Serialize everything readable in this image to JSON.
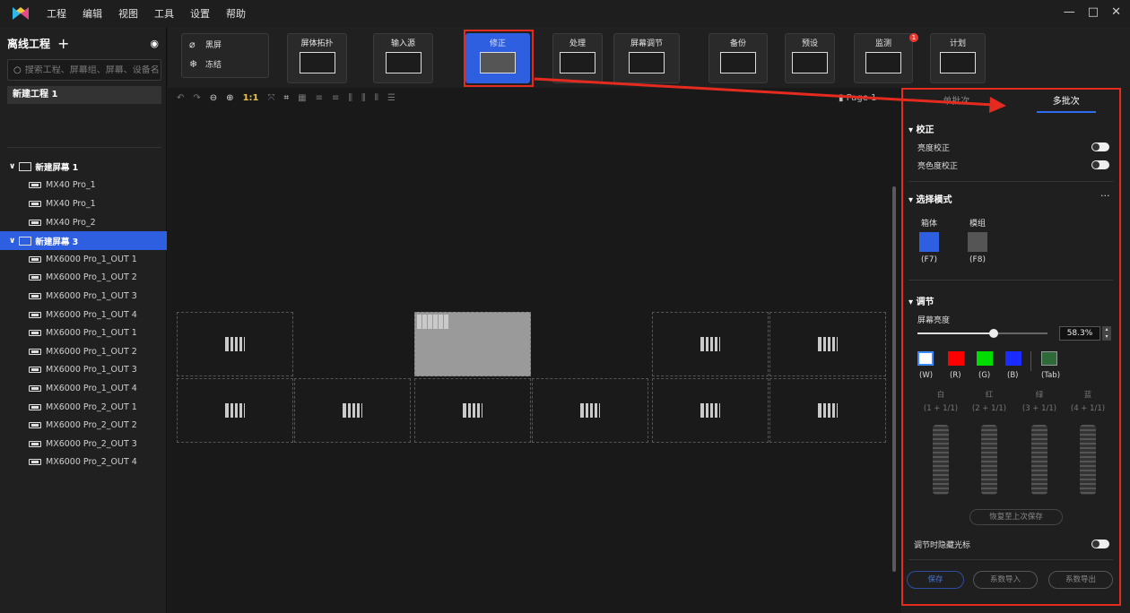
{
  "menubar": {
    "items": [
      "工程",
      "编辑",
      "视图",
      "工具",
      "设置",
      "帮助"
    ],
    "window_controls": [
      "—",
      "□",
      "✕"
    ]
  },
  "left": {
    "title": "离线工程",
    "add": "+",
    "search_placeholder": "搜索工程、屏幕组、屏幕、设备名...",
    "project_item": "新建工程 1",
    "tree": [
      {
        "type": "screen",
        "label": "新建屏幕 1",
        "selected": false
      },
      {
        "type": "device",
        "label": "MX40 Pro_1"
      },
      {
        "type": "device",
        "label": "MX40 Pro_1"
      },
      {
        "type": "device",
        "label": "MX40 Pro_2"
      },
      {
        "type": "screen",
        "label": "新建屏幕 3",
        "selected": true
      },
      {
        "type": "device",
        "label": "MX6000 Pro_1_OUT 1"
      },
      {
        "type": "device",
        "label": "MX6000 Pro_1_OUT 2"
      },
      {
        "type": "device",
        "label": "MX6000 Pro_1_OUT 3"
      },
      {
        "type": "device",
        "label": "MX6000 Pro_1_OUT 4"
      },
      {
        "type": "device",
        "label": "MX6000 Pro_1_OUT 1"
      },
      {
        "type": "device",
        "label": "MX6000 Pro_1_OUT 2"
      },
      {
        "type": "device",
        "label": "MX6000 Pro_1_OUT 3"
      },
      {
        "type": "device",
        "label": "MX6000 Pro_1_OUT 4"
      },
      {
        "type": "device",
        "label": "MX6000 Pro_2_OUT 1"
      },
      {
        "type": "device",
        "label": "MX6000 Pro_2_OUT 2"
      },
      {
        "type": "device",
        "label": "MX6000 Pro_2_OUT 3"
      },
      {
        "type": "device",
        "label": "MX6000 Pro_2_OUT 4"
      }
    ]
  },
  "ribbon": {
    "black_screen": "黑屏",
    "freeze": "冻结",
    "buttons": [
      {
        "label": "屏体拓扑",
        "icon": "topology-icon"
      },
      {
        "label": "输入源",
        "icon": "input-source-icon"
      },
      {
        "label": "修正",
        "icon": "correction-icon",
        "active": true
      },
      {
        "label": "处理",
        "icon": "processing-icon"
      },
      {
        "label": "屏幕调节",
        "icon": "screen-adjust-icon"
      },
      {
        "label": "备份",
        "icon": "backup-icon"
      },
      {
        "label": "预设",
        "icon": "preset-icon"
      },
      {
        "label": "监测",
        "icon": "monitor-icon",
        "badge": "1"
      },
      {
        "label": "计划",
        "icon": "schedule-icon"
      }
    ]
  },
  "canvas": {
    "zoom_label": "1:1",
    "page_label": "Page 1"
  },
  "right": {
    "tabs": [
      "单批次",
      "多批次"
    ],
    "active_tab": 1,
    "correction": {
      "title": "校正",
      "brightness": "亮度校正",
      "chroma": "亮色度校正"
    },
    "select_mode": {
      "title": "选择模式",
      "more": "···",
      "modes": [
        {
          "label": "箱体",
          "key": "(F7)"
        },
        {
          "label": "模组",
          "key": "(F8)"
        }
      ]
    },
    "adjust": {
      "title": "调节",
      "screen_brightness": "屏幕亮度",
      "brightness_value": "58.3%",
      "brightness_level": 58.3,
      "swatches": [
        {
          "key": "(W)",
          "color": "#ffffff"
        },
        {
          "key": "(R)",
          "color": "#ff0000"
        },
        {
          "key": "(G)",
          "color": "#00dd00"
        },
        {
          "key": "(B)",
          "color": "#1a2cff"
        }
      ],
      "tab_key": "(Tab)",
      "channels": [
        {
          "name": "白",
          "formula": "(1 + 1/1)"
        },
        {
          "name": "红",
          "formula": "(2 + 1/1)"
        },
        {
          "name": "绿",
          "formula": "(3 + 1/1)"
        },
        {
          "name": "蓝",
          "formula": "(4 + 1/1)"
        }
      ],
      "restore": "恢复至上次保存",
      "hide_cursor": "调节时隐藏光标"
    },
    "buttons": {
      "save": "保存",
      "import": "系数导入",
      "export": "系数导出"
    }
  }
}
